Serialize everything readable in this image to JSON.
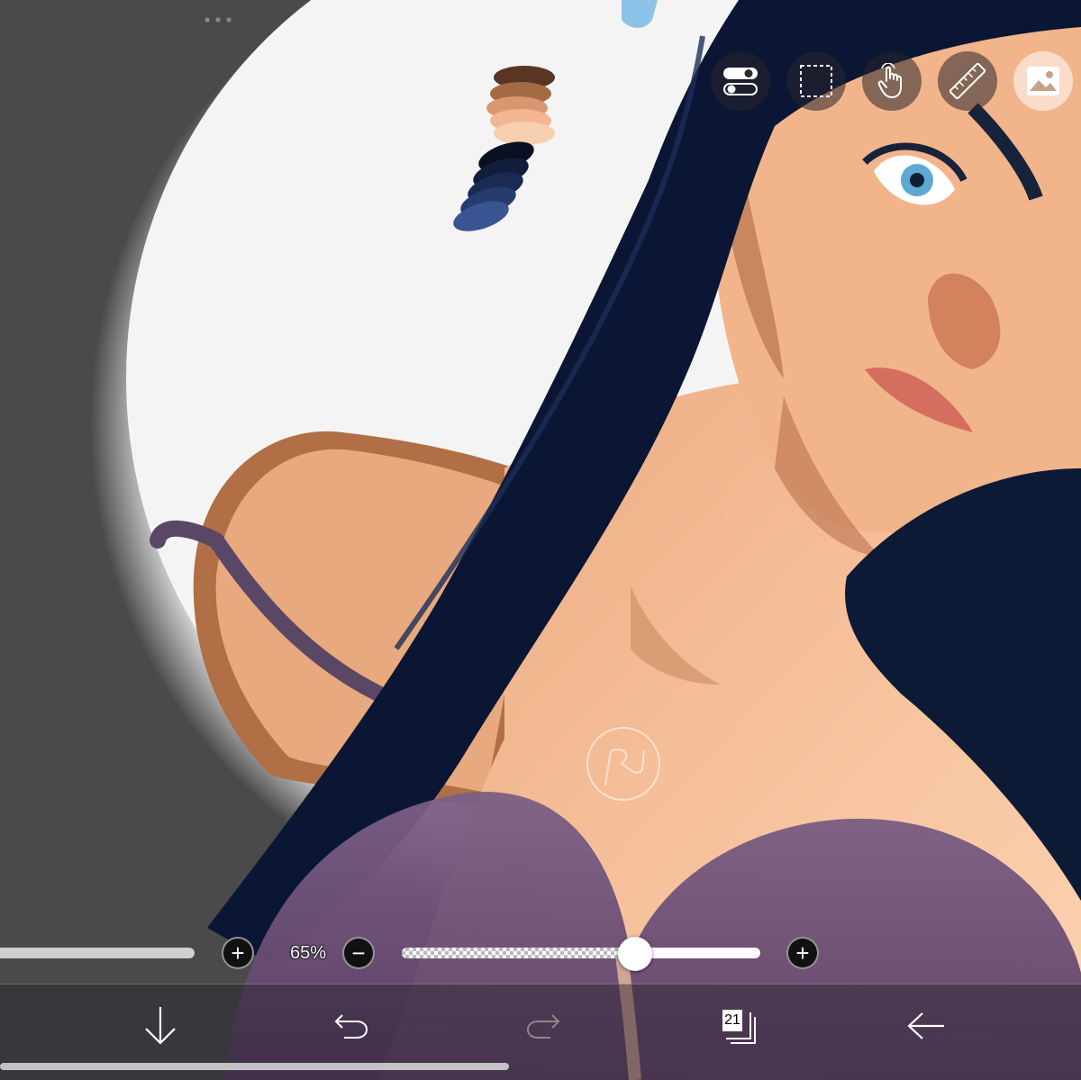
{
  "app": {
    "top_tools": [
      {
        "name": "toggle-tools",
        "icon": "toggle-switch-icon"
      },
      {
        "name": "selection",
        "icon": "dashed-rectangle-icon"
      },
      {
        "name": "hand-gesture",
        "icon": "touch-hand-icon"
      },
      {
        "name": "ruler",
        "icon": "ruler-icon"
      },
      {
        "name": "reference-image",
        "icon": "image-icon",
        "active": true
      }
    ],
    "brush_size": {
      "level": 0.24,
      "plus_label": "+"
    },
    "opacity": {
      "value_label": "65%",
      "value": 0.65,
      "minus_label": "−",
      "plus_label": "+"
    },
    "bottom_bar": {
      "download_icon": "arrow-down-icon",
      "undo_icon": "undo-icon",
      "redo_icon": "redo-icon",
      "layers_count": "21",
      "back_icon": "arrow-left-icon"
    },
    "colors": {
      "background_gray": "#4a4a4a",
      "canvas_white": "#f3f3f3",
      "hair": "#0c1a3a",
      "skin": "#f0b48a",
      "bra": "#6f5278",
      "palette_skin": [
        "#5a3524",
        "#a36a46",
        "#d89671",
        "#f2b792",
        "#f8cfae"
      ],
      "palette_hair": [
        "#0a1022",
        "#111d3a",
        "#1a2a52",
        "#263b6e",
        "#3a5491"
      ]
    }
  }
}
